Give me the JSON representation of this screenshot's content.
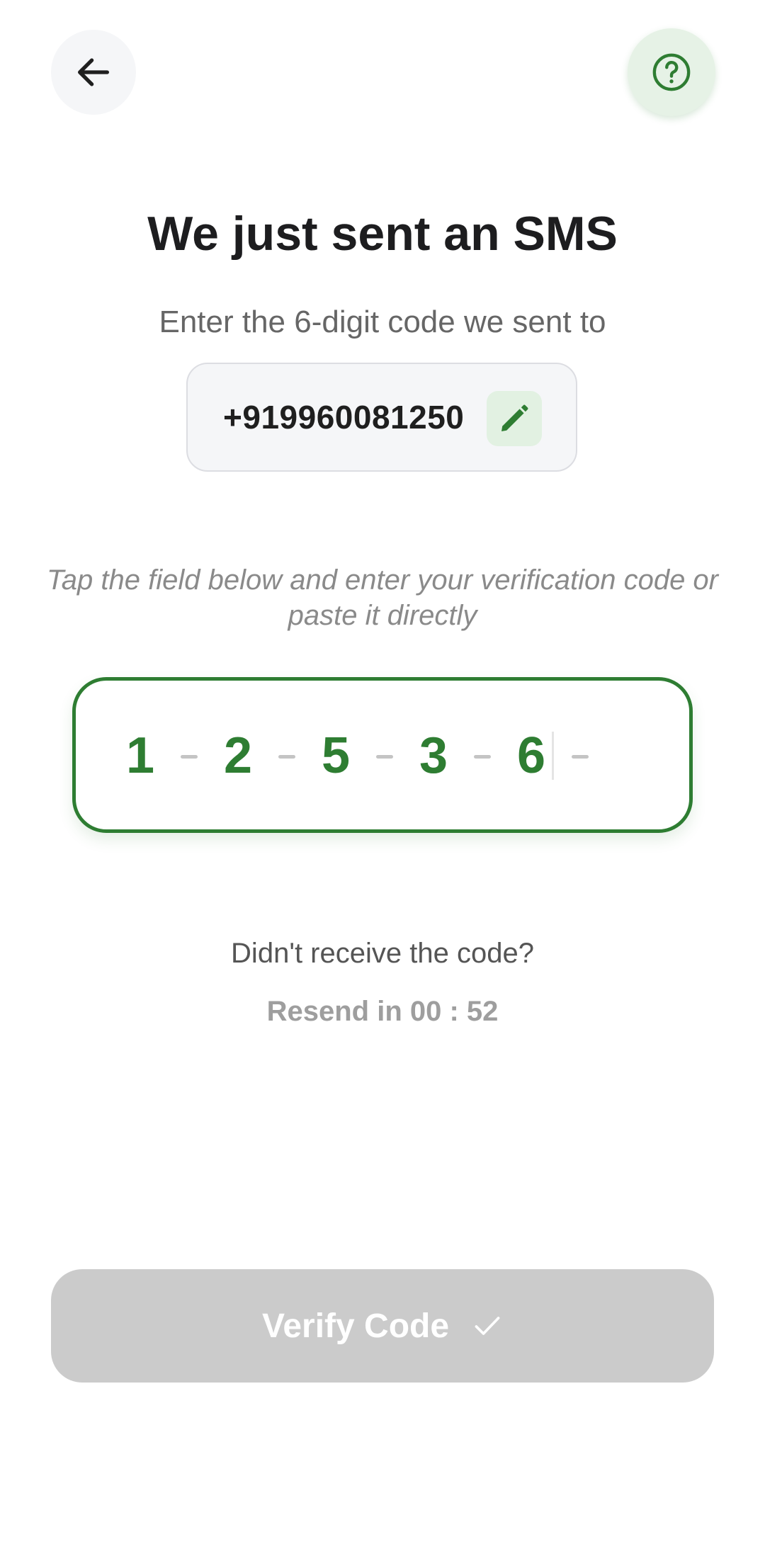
{
  "header": {
    "back_icon": "arrow-left-icon",
    "help_icon": "help-circle-icon"
  },
  "title": "We just sent an SMS",
  "subtitle": "Enter the 6-digit code we sent to",
  "phone": {
    "number": "+919960081250",
    "edit_icon": "pencil-icon"
  },
  "hint": "Tap the field below and enter your verification code or paste it directly",
  "otp": {
    "digits": [
      "1",
      "2",
      "5",
      "3",
      "6",
      ""
    ],
    "entered_count": 5,
    "length": 6
  },
  "resend": {
    "question": "Didn't receive the code?",
    "timer": "Resend in 00 : 52"
  },
  "verify_button": {
    "label": "Verify Code",
    "icon": "check-icon",
    "enabled": false
  },
  "colors": {
    "accent": "#2e7d32",
    "accent_light": "#e2f1e2",
    "disabled": "#cbcbcb",
    "text_primary": "#1d1d1f",
    "text_secondary": "#666666"
  }
}
